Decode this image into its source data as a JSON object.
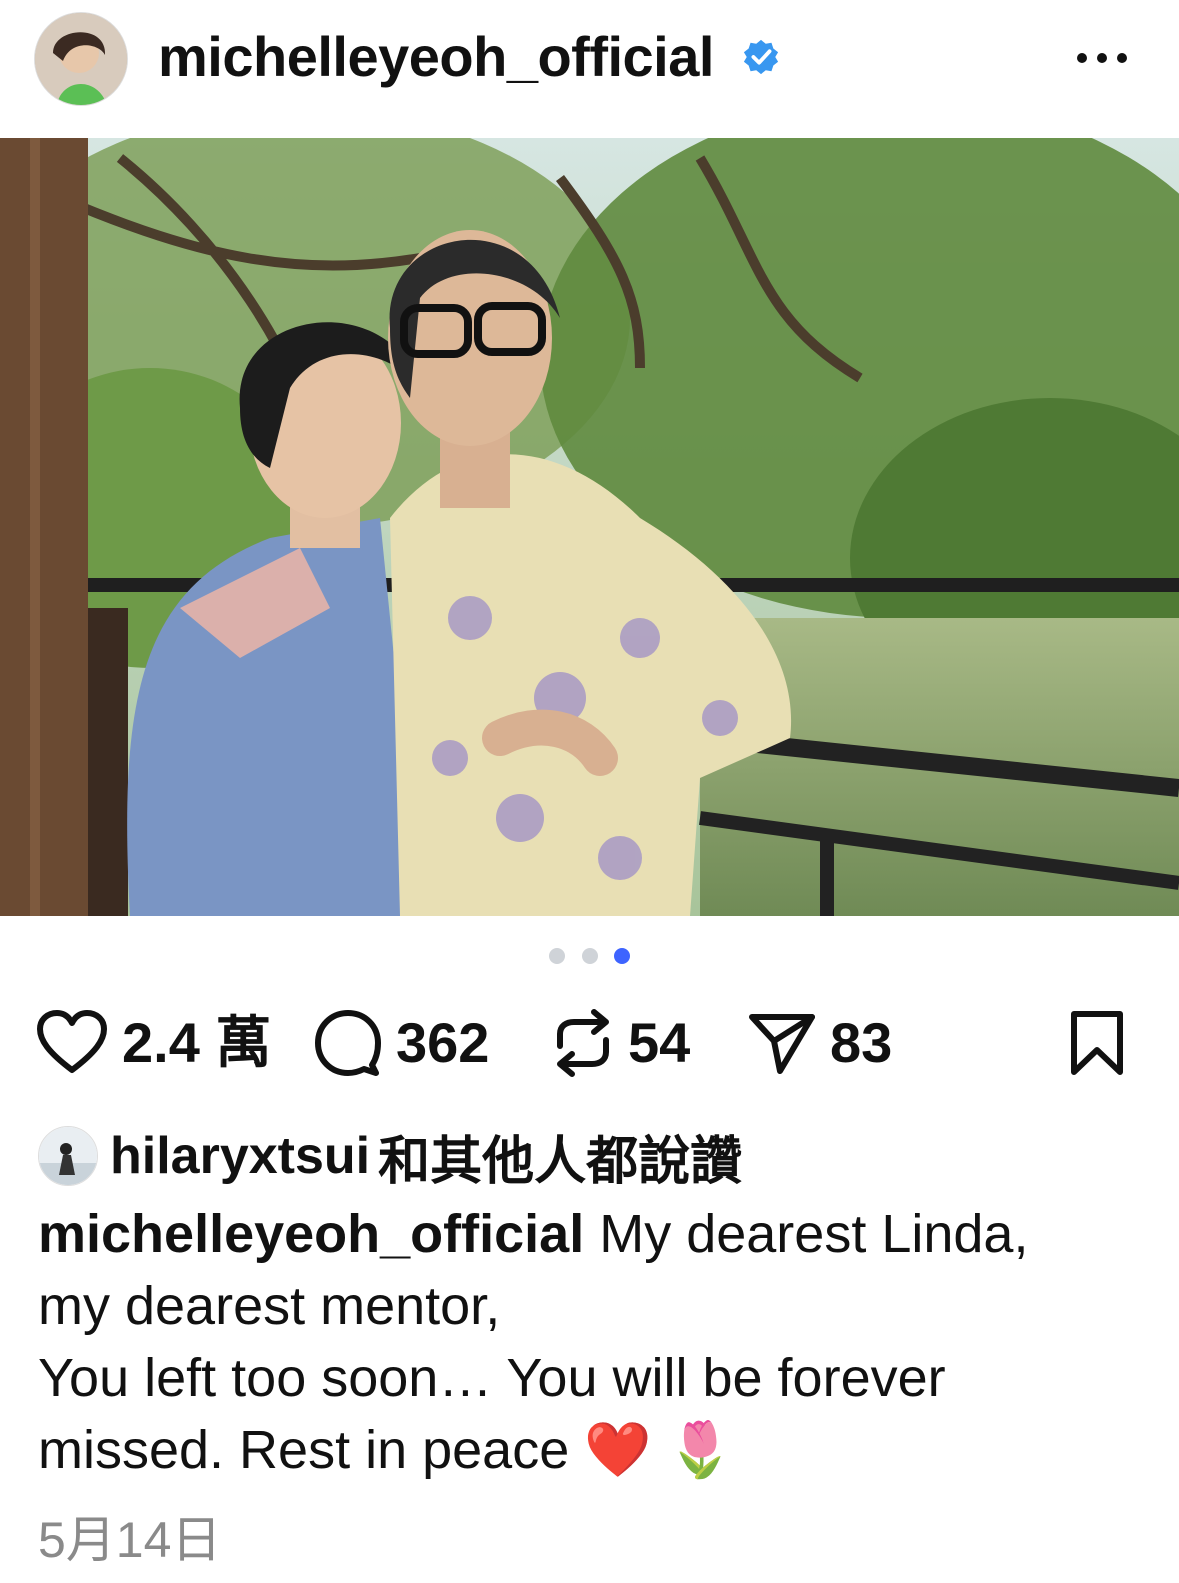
{
  "post": {
    "username": "michelleyeoh_official",
    "verified_icon": "verified-badge-icon",
    "more_icon": "more-options-icon",
    "carousel": {
      "total": 3,
      "active_index": 3
    },
    "stats": {
      "likes": "2.4 萬",
      "comments": "362",
      "reposts": "54",
      "shares": "83"
    },
    "liked_by": {
      "user": "hilaryxtsui",
      "suffix": "和其他人都說讚"
    },
    "caption": {
      "user": "michelleyeoh_official",
      "line1": "My dearest Linda,",
      "line2": "my dearest mentor,",
      "line3": "You left too soon… You will be forever",
      "line4": "missed. Rest in peace ❤️ 🌷"
    },
    "date": "5月14日",
    "colors": {
      "verified": "#3897f0",
      "active_dot": "#3e64ff",
      "inactive_dot": "#cfd3d8",
      "date_text": "#8a8a8a"
    }
  }
}
